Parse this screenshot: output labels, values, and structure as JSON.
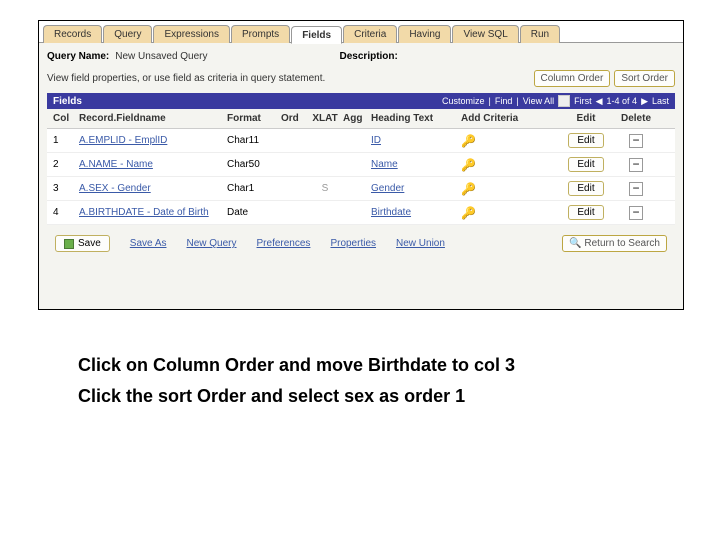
{
  "tabs": {
    "records": "Records",
    "query": "Query",
    "expressions": "Expressions",
    "prompts": "Prompts",
    "fields": "Fields",
    "criteria": "Criteria",
    "having": "Having",
    "viewsql": "View SQL",
    "run": "Run"
  },
  "labels": {
    "queryName": "Query Name:",
    "description": "Description:",
    "help": "View field properties, or use field as criteria in query statement."
  },
  "values": {
    "queryName": "New Unsaved Query"
  },
  "buttons": {
    "columnOrder": "Column Order",
    "sortOrder": "Sort Order",
    "save": "Save",
    "returnToSearch": "Return to Search",
    "edit": "Edit",
    "minus": "−"
  },
  "gridbar": {
    "title": "Fields",
    "customize": "Customize",
    "find": "Find",
    "viewall": "View All",
    "first": "First",
    "last": "Last",
    "range": "1-4 of 4",
    "prev": "◀",
    "next": "▶"
  },
  "columns": {
    "col": "Col",
    "record": "Record.Fieldname",
    "format": "Format",
    "ord": "Ord",
    "xlat": "XLAT",
    "agg": "Agg",
    "heading": "Heading Text",
    "addcrit": "Add Criteria",
    "edit": "Edit",
    "delete": "Delete"
  },
  "rows": [
    {
      "col": "1",
      "record": "A.EMPLID - EmplID",
      "format": "Char11",
      "ord": "",
      "xlat": "",
      "heading": "ID"
    },
    {
      "col": "2",
      "record": "A.NAME - Name",
      "format": "Char50",
      "ord": "",
      "xlat": "",
      "heading": "Name"
    },
    {
      "col": "3",
      "record": "A.SEX - Gender",
      "format": "Char1",
      "ord": "",
      "xlat": "S",
      "heading": "Gender"
    },
    {
      "col": "4",
      "record": "A.BIRTHDATE - Date of Birth",
      "format": "Date",
      "ord": "",
      "xlat": "",
      "heading": "Birthdate"
    }
  ],
  "footer": {
    "saveAs": "Save As",
    "newQuery": "New Query",
    "preferences": "Preferences",
    "properties": "Properties",
    "newUnion": "New Union"
  },
  "instructions": {
    "line1": "Click on Column Order and move Birthdate to col 3",
    "line2": "Click the sort Order and select sex as order 1"
  }
}
